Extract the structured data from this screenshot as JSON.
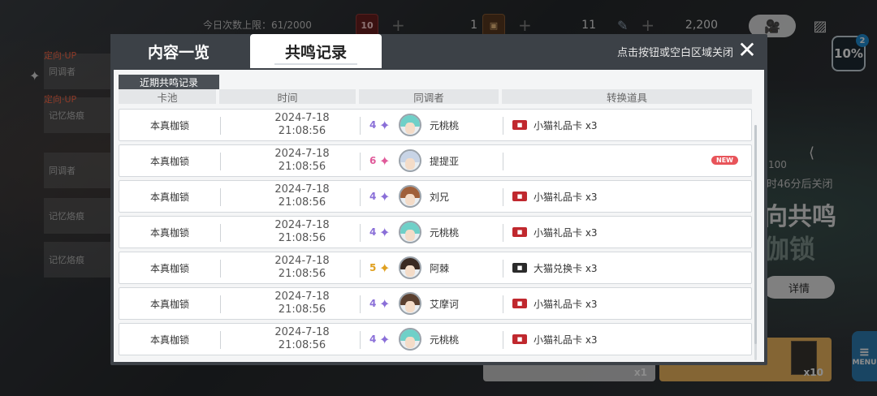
{
  "background": {
    "daily_limit": "今日次数上限：61/2000",
    "resources": [
      {
        "icon": "red-ticket-icon",
        "chip": "10",
        "value": "1"
      },
      {
        "icon": "gold-ticket-icon",
        "chip": "",
        "value": "11"
      },
      {
        "icon": "pen-icon",
        "chip": "",
        "value": "2,200"
      }
    ],
    "left_tabs": [
      {
        "up": "定向·UP",
        "label": "同调者"
      },
      {
        "up": "定向·UP",
        "label": "记忆烙痕"
      },
      {
        "up": "",
        "label": "同调者"
      },
      {
        "up": "",
        "label": "记忆烙痕"
      },
      {
        "up": "",
        "label": "记忆烙痕"
      }
    ],
    "right_info": {
      "count": "100",
      "close_timer": "时46分后关闭",
      "title_line1": "向共鸣",
      "title_line2": "伽锁"
    },
    "detail_label": "详情",
    "card1_count": "x1",
    "card2_count": "x10",
    "menu_label": "MENU",
    "progress_percent": "10%",
    "progress_notify": "2"
  },
  "modal": {
    "tabs": [
      {
        "label": "内容一览",
        "active": false
      },
      {
        "label": "共鸣记录",
        "active": true
      }
    ],
    "close_hint": "点击按钮或空白区域关闭",
    "close_icon": "✕",
    "section_title": "近期共鸣记录",
    "columns": {
      "pool": "卡池",
      "time": "时间",
      "resonator": "同调者",
      "item": "转换道具"
    },
    "new_label": "NEW",
    "rows": [
      {
        "pool": "本真枷锁",
        "date": "2024-7-18",
        "clock": "21:08:56",
        "rarity": "4",
        "rarity_color": "#8a6fd8",
        "resonator": "元桃桃",
        "hair": "#6fd0c8",
        "item": "小猫礼品卡 x3",
        "item_color": "#c0282e",
        "is_new": false
      },
      {
        "pool": "本真枷锁",
        "date": "2024-7-18",
        "clock": "21:08:56",
        "rarity": "6",
        "rarity_color": "#e05a9a",
        "resonator": "提提亚",
        "hair": "#c8d4e6",
        "item": "",
        "item_color": "",
        "is_new": true
      },
      {
        "pool": "本真枷锁",
        "date": "2024-7-18",
        "clock": "21:08:56",
        "rarity": "4",
        "rarity_color": "#8a6fd8",
        "resonator": "刘兄",
        "hair": "#a0603a",
        "item": "小猫礼品卡 x3",
        "item_color": "#c0282e",
        "is_new": false
      },
      {
        "pool": "本真枷锁",
        "date": "2024-7-18",
        "clock": "21:08:56",
        "rarity": "4",
        "rarity_color": "#8a6fd8",
        "resonator": "元桃桃",
        "hair": "#6fd0c8",
        "item": "小猫礼品卡 x3",
        "item_color": "#c0282e",
        "is_new": false
      },
      {
        "pool": "本真枷锁",
        "date": "2024-7-18",
        "clock": "21:08:56",
        "rarity": "5",
        "rarity_color": "#e0a020",
        "resonator": "阿棘",
        "hair": "#3a2a22",
        "item": "大猫兑换卡 x3",
        "item_color": "#2a2a2a",
        "is_new": false
      },
      {
        "pool": "本真枷锁",
        "date": "2024-7-18",
        "clock": "21:08:56",
        "rarity": "4",
        "rarity_color": "#8a6fd8",
        "resonator": "艾摩诃",
        "hair": "#5a4030",
        "item": "小猫礼品卡 x3",
        "item_color": "#c0282e",
        "is_new": false
      },
      {
        "pool": "本真枷锁",
        "date": "2024-7-18",
        "clock": "21:08:56",
        "rarity": "4",
        "rarity_color": "#8a6fd8",
        "resonator": "元桃桃",
        "hair": "#6fd0c8",
        "item": "小猫礼品卡 x3",
        "item_color": "#c0282e",
        "is_new": false
      }
    ]
  }
}
